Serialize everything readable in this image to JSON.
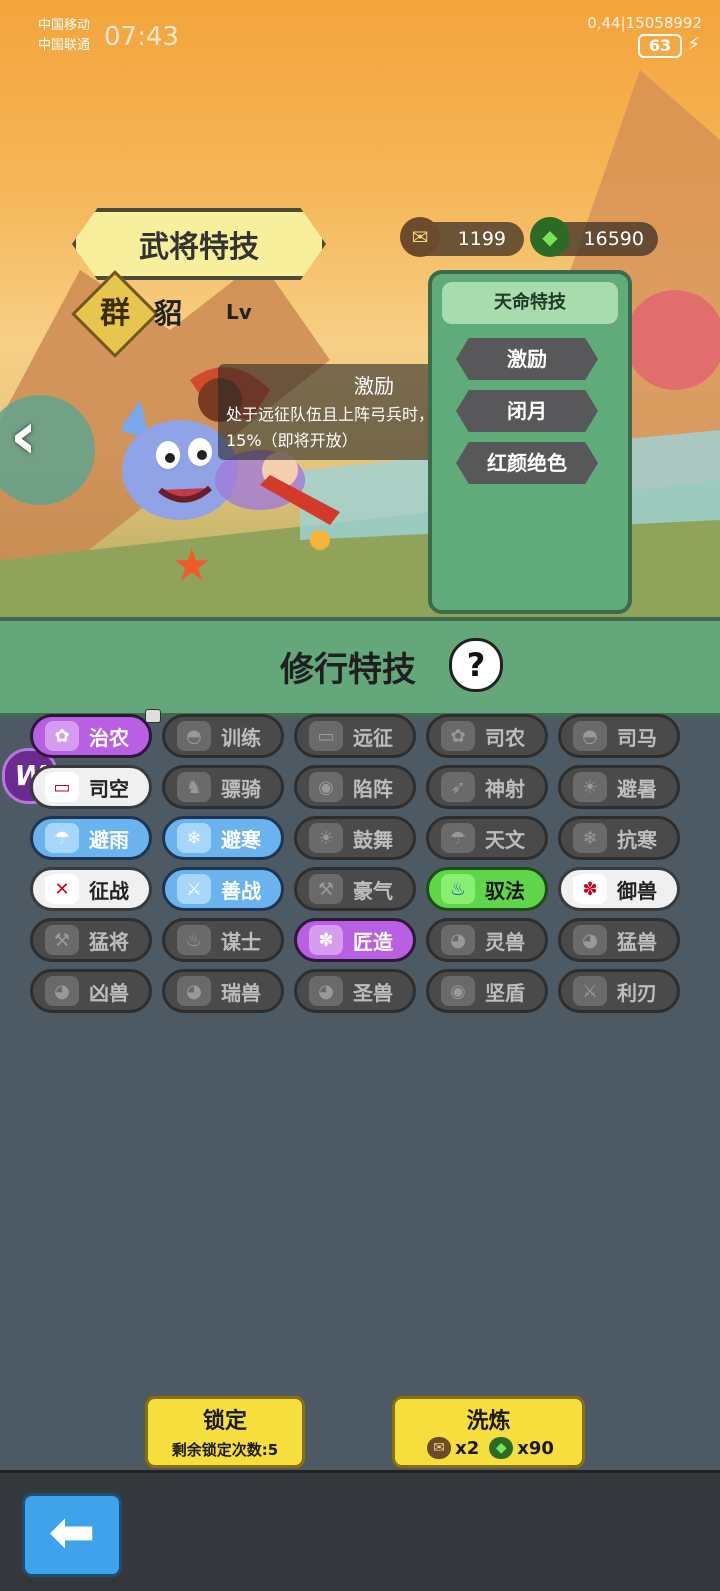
{
  "status": {
    "carrier1": "中国移动",
    "carrier2": "中国联通",
    "time": "07:43",
    "network": "0,44|15058992",
    "battery": "63"
  },
  "header": {
    "title": "武将特技"
  },
  "resources": {
    "currency1": "1199",
    "currency2": "16590"
  },
  "hero": {
    "faction": "群",
    "name": "貂",
    "level": "Lv"
  },
  "tooltip": {
    "title": "激励",
    "body": "处于远征队伍且上阵弓兵时，成功率提高15%（即将开放）"
  },
  "fate_panel": {
    "title": "天命特技",
    "skills": [
      "激励",
      "闭月",
      "红颜绝色"
    ]
  },
  "training": {
    "title": "修行特技",
    "help": "?"
  },
  "skills": [
    {
      "label": "治农",
      "style": "purple",
      "icon": "wheat-icon"
    },
    {
      "label": "训练",
      "style": "gray",
      "icon": "helmet-icon"
    },
    {
      "label": "远征",
      "style": "gray",
      "icon": "wood-icon"
    },
    {
      "label": "司农",
      "style": "gray",
      "icon": "wheat-icon"
    },
    {
      "label": "司马",
      "style": "gray",
      "icon": "helmet-icon"
    },
    {
      "label": "司空",
      "style": "white",
      "icon": "wood-icon"
    },
    {
      "label": "骠骑",
      "style": "gray",
      "icon": "horse-icon"
    },
    {
      "label": "陷阵",
      "style": "gray",
      "icon": "shield-icon"
    },
    {
      "label": "神射",
      "style": "gray",
      "icon": "archer-icon"
    },
    {
      "label": "避暑",
      "style": "gray",
      "icon": "sun-icon"
    },
    {
      "label": "避雨",
      "style": "blue",
      "icon": "rain-icon"
    },
    {
      "label": "避寒",
      "style": "blue",
      "icon": "snow-icon"
    },
    {
      "label": "鼓舞",
      "style": "gray",
      "icon": "sun-icon"
    },
    {
      "label": "天文",
      "style": "gray",
      "icon": "rain-icon"
    },
    {
      "label": "抗寒",
      "style": "gray",
      "icon": "snow-icon"
    },
    {
      "label": "征战",
      "style": "white",
      "icon": "axes-icon"
    },
    {
      "label": "善战",
      "style": "blue",
      "icon": "sword-icon"
    },
    {
      "label": "豪气",
      "style": "gray",
      "icon": "axe-icon"
    },
    {
      "label": "驭法",
      "style": "green",
      "icon": "flame-icon"
    },
    {
      "label": "御兽",
      "style": "white",
      "icon": "paw-icon"
    },
    {
      "label": "猛将",
      "style": "gray",
      "icon": "axe-icon"
    },
    {
      "label": "谋士",
      "style": "gray",
      "icon": "flame-icon"
    },
    {
      "label": "匠造",
      "style": "purple",
      "icon": "paw-icon"
    },
    {
      "label": "灵兽",
      "style": "gray",
      "icon": "cat-icon"
    },
    {
      "label": "猛兽",
      "style": "gray",
      "icon": "cat-icon"
    },
    {
      "label": "凶兽",
      "style": "gray",
      "icon": "cat-icon"
    },
    {
      "label": "瑞兽",
      "style": "gray",
      "icon": "cat-icon"
    },
    {
      "label": "圣兽",
      "style": "gray",
      "icon": "cat-icon"
    },
    {
      "label": "坚盾",
      "style": "gray",
      "icon": "shield-icon"
    },
    {
      "label": "利刃",
      "style": "gray",
      "icon": "blade-icon"
    }
  ],
  "actions": {
    "lock": {
      "title": "锁定",
      "sub": "剩余锁定次数:5"
    },
    "wash": {
      "title": "洗炼",
      "cost1": "x2",
      "cost2": "x90"
    }
  },
  "colors": {
    "accent_green": "#64a77b",
    "button_yellow": "#f6de3c",
    "skill_purple": "#b85fe4",
    "skill_blue": "#6bb3ee"
  }
}
